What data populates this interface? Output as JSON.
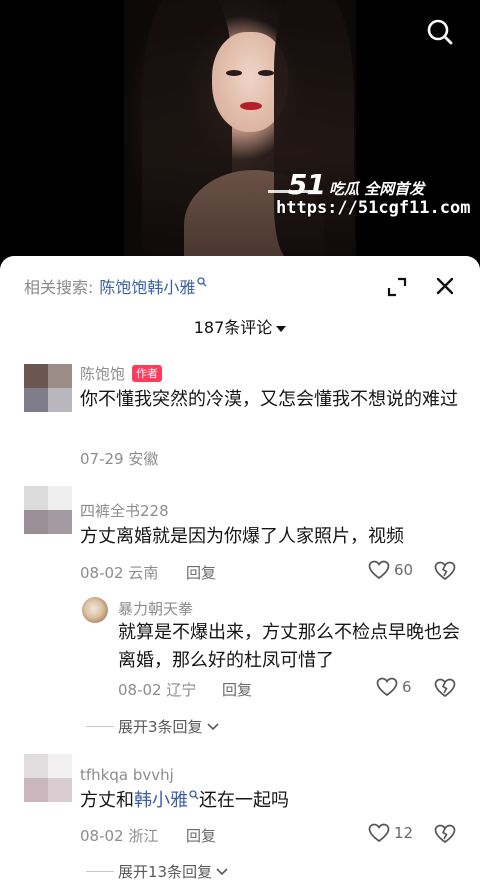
{
  "video": {
    "watermark_number": "51",
    "watermark_text": "吃瓜 全网首发",
    "watermark_url": "https://51cgf11.com",
    "search_icon": "search-icon"
  },
  "sheet": {
    "related_prefix": "相关搜索:",
    "related_term": "陈饱饱韩小雅",
    "comment_count": "187条评论",
    "expand_icon": "expand-icon",
    "close_icon": "close-icon"
  },
  "comments": [
    {
      "username": "陈饱饱",
      "badge": "作者",
      "text": "你不懂我突然的冷漠，又怎会懂我不想说的难过",
      "date": "07-29",
      "location": "安徽"
    },
    {
      "username": "四裤全书228",
      "text": "方丈离婚就是因为你爆了人家照片，视频",
      "date": "08-02",
      "location": "云南",
      "reply_label": "回复",
      "likes": "60",
      "replies": [
        {
          "username": "暴力朝天拳",
          "text": "就算是不爆出来，方丈那么不检点早晚也会离婚，那么好的杜凤可惜了",
          "date": "08-02",
          "location": "辽宁",
          "reply_label": "回复",
          "likes": "6"
        }
      ],
      "expand_label": "展开3条回复"
    },
    {
      "username": "tfhkqa bvvhj",
      "text_before": "方丈和",
      "mention": "韩小雅",
      "text_after": "还在一起吗",
      "date": "08-02",
      "location": "浙江",
      "reply_label": "回复",
      "likes": "12",
      "expand_label": "展开13条回复"
    }
  ],
  "colors": {
    "accent_link": "#3a5ea8",
    "badge": "#ff3b5c",
    "muted": "#8d8d8d"
  }
}
